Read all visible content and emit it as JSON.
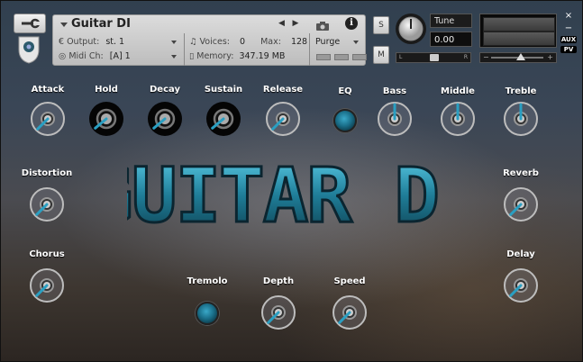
{
  "header": {
    "instrument_name": "Guitar DI",
    "output_label": "Output:",
    "output_value": "st. 1",
    "voices_label": "Voices:",
    "voices_value": "0",
    "max_label": "Max:",
    "max_value": "128",
    "purge_label": "Purge",
    "midi_label": "Midi Ch:",
    "midi_value": "[A] 1",
    "memory_label": "Memory:",
    "memory_value": "347.19 MB",
    "s_button": "S",
    "m_button": "M",
    "tune_label": "Tune",
    "tune_value": "0.00",
    "pan_left": "L",
    "pan_right": "R",
    "vol_minus": "−",
    "vol_plus": "+",
    "aux_label": "AUX",
    "pv_label": "PV",
    "close": "×",
    "minimize": "−",
    "info": "i"
  },
  "knobs": {
    "attack": "Attack",
    "hold": "Hold",
    "decay": "Decay",
    "sustain": "Sustain",
    "release": "Release",
    "eq": "EQ",
    "bass": "Bass",
    "middle": "Middle",
    "treble": "Treble",
    "distortion": "Distortion",
    "reverb": "Reverb",
    "chorus": "Chorus",
    "delay": "Delay",
    "tremolo": "Tremolo",
    "depth": "Depth",
    "speed": "Speed"
  },
  "center_title": "GUITAR DI",
  "colors": {
    "accent": "#2a9fc2",
    "knob_ring": "#c0c0c0",
    "knob_dark": "#0a0a0a"
  }
}
